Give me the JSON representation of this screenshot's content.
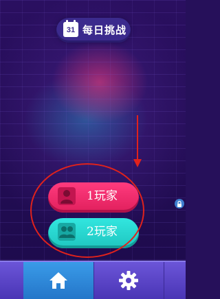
{
  "daily_challenge": {
    "label": "每日挑战",
    "calendar_day": "31"
  },
  "modes": [
    {
      "label": "1玩家",
      "icon": "single-player-icon",
      "color": "#ff3b7e"
    },
    {
      "label": "2玩家",
      "icon": "two-player-icon",
      "color": "#2fd9d3"
    }
  ],
  "bottom_nav": [
    {
      "icon": "home-icon",
      "active": true
    },
    {
      "icon": "gear-icon",
      "active": false
    }
  ],
  "annotation": {
    "color": "#e0221c"
  }
}
